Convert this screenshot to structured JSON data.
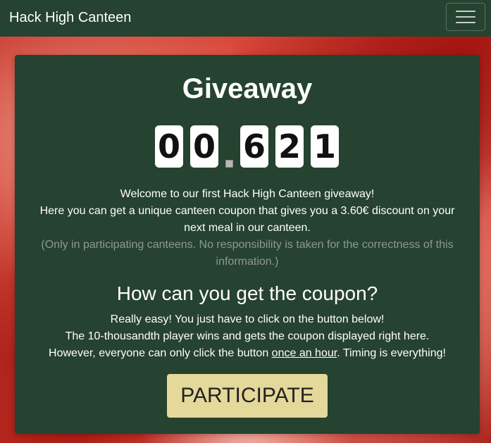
{
  "navbar": {
    "brand": "Hack High Canteen"
  },
  "card": {
    "title": "Giveaway",
    "counter": {
      "digits_before": [
        "0",
        "0"
      ],
      "digits_after": [
        "6",
        "2",
        "1"
      ]
    },
    "intro_line1": "Welcome to our first Hack High Canteen giveaway!",
    "intro_line2": "Here you can get a unique canteen coupon that gives you a 3.60€ discount on your next meal in our canteen.",
    "disclaimer": "(Only in participating canteens. No responsibility is taken for the correctness of this information.)",
    "subtitle": "How can you get the coupon?",
    "howto_line1": "Really easy! You just have to click on the button below!",
    "howto_line2": "The 10-thousandth player wins and gets the coupon displayed right here.",
    "howto_line3_pre": "However, everyone can only click the button ",
    "howto_line3_link": "once an hour",
    "howto_line3_post": ". Timing is everything!",
    "button_label": "PARTICIPATE"
  },
  "colors": {
    "panel": "#264230",
    "button": "#e4d89a",
    "muted_text": "#8d9a91"
  }
}
